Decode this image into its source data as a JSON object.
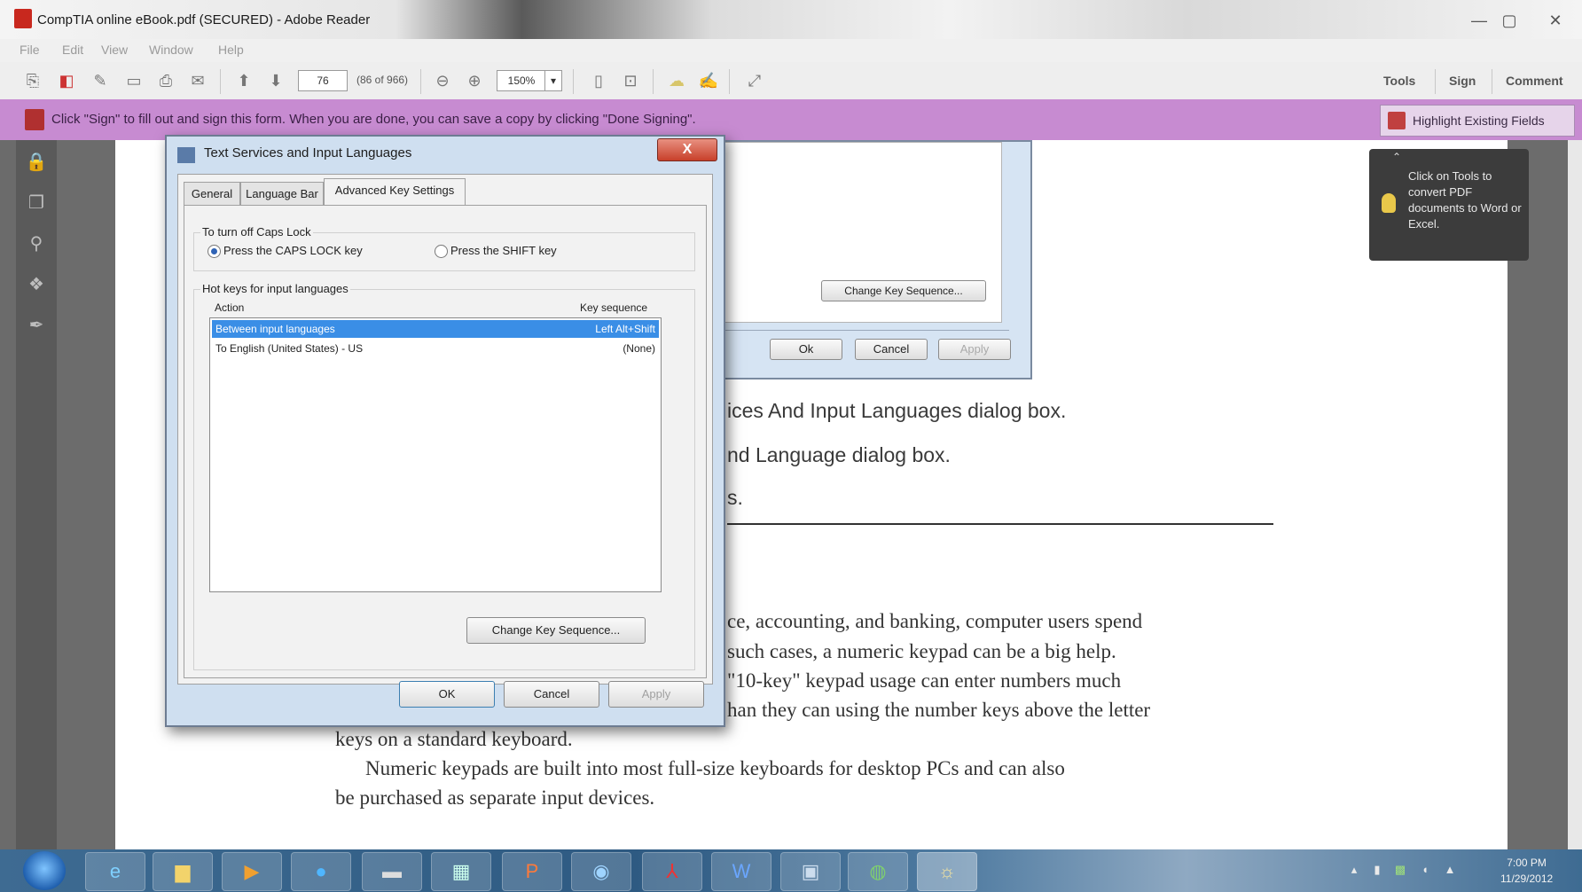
{
  "window": {
    "title": "CompTIA online eBook.pdf (SECURED) - Adobe Reader",
    "controls": [
      "—",
      "▢",
      "✕"
    ]
  },
  "menu": {
    "items": [
      "File",
      "Edit",
      "View",
      "Window",
      "Help"
    ]
  },
  "toolbar": {
    "page_number": "76",
    "page_total": "(86 of 966)",
    "zoom": "150%",
    "tools": "Tools",
    "sign": "Sign",
    "comment": "Comment"
  },
  "signbar": {
    "message": "Click \"Sign\" to fill out and sign this form. When you are done, you can save a copy by clicking \"Done Signing\".",
    "highlight_button": "Highlight Existing Fields"
  },
  "tooltip": {
    "text": "Click on Tools to convert PDF documents to Word or Excel."
  },
  "bg_dialog": {
    "change_key_sequence": "Change Key Sequence...",
    "ok": "Ok",
    "cancel": "Cancel",
    "apply": "Apply"
  },
  "doc": {
    "line1": "ices And Input Languages dialog box.",
    "line2": "nd Language dialog box.",
    "line3": "s.",
    "para1": [
      "ce, accounting, and banking, computer users spend",
      "such cases, a numeric keypad can be a big help.",
      "\"10-key\" keypad usage can enter numbers much",
      "han they can using the number keys above the letter"
    ],
    "para1_last": "keys on a standard keyboard.",
    "para2_line1": "Numeric keypads are built into most full-size keyboards for desktop PCs and can also",
    "para2_line2": "be purchased as separate input devices."
  },
  "dialog": {
    "title": "Text Services and Input Languages",
    "close": "X",
    "tabs": [
      "General",
      "Language Bar",
      "Advanced Key Settings"
    ],
    "capslock_group": "To turn off Caps Lock",
    "radio_capslock": "Press the CAPS LOCK key",
    "radio_shift": "Press the SHIFT key",
    "hotkeys_group": "Hot keys for input languages",
    "col_action": "Action",
    "col_key": "Key sequence",
    "rows": [
      {
        "action": "Between input languages",
        "key": "Left Alt+Shift"
      },
      {
        "action": "To English (United States) - US",
        "key": "(None)"
      }
    ],
    "change_key_sequence": "Change Key Sequence...",
    "ok": "OK",
    "cancel": "Cancel",
    "apply": "Apply"
  },
  "taskbar": {
    "time": "7:00 PM",
    "date": "11/29/2012"
  },
  "colors": {
    "signbar": "#c78bd1",
    "selection": "#3a8ee6",
    "taskbar": "#2e5a82"
  }
}
